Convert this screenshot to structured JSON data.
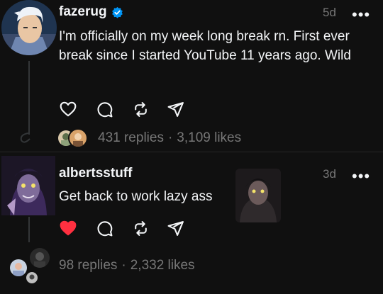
{
  "post": {
    "username": "fazerug",
    "verified": true,
    "time": "5d",
    "more_label": "•••",
    "text": "I'm officially on my week long break rn. First ever break since I started YouTube 11 years ago. Wild",
    "stats": {
      "replies": "431 replies",
      "separator": "·",
      "likes": "3,109 likes"
    },
    "actions": [
      "heart-icon",
      "comment-icon",
      "repost-icon",
      "share-icon"
    ]
  },
  "reply": {
    "username": "albertsstuff",
    "time": "3d",
    "more_label": "•••",
    "text": "Get back to work lazy ass",
    "liked": true,
    "stats": {
      "replies": "98 replies",
      "separator": "·",
      "likes": "2,332 likes"
    },
    "actions": [
      "heart-filled-icon",
      "comment-icon",
      "repost-icon",
      "share-icon"
    ]
  },
  "colors": {
    "background": "#101010",
    "text": "#f3f5f7",
    "muted": "#777777",
    "verified": "#0095f6",
    "liked": "#ff3040"
  }
}
